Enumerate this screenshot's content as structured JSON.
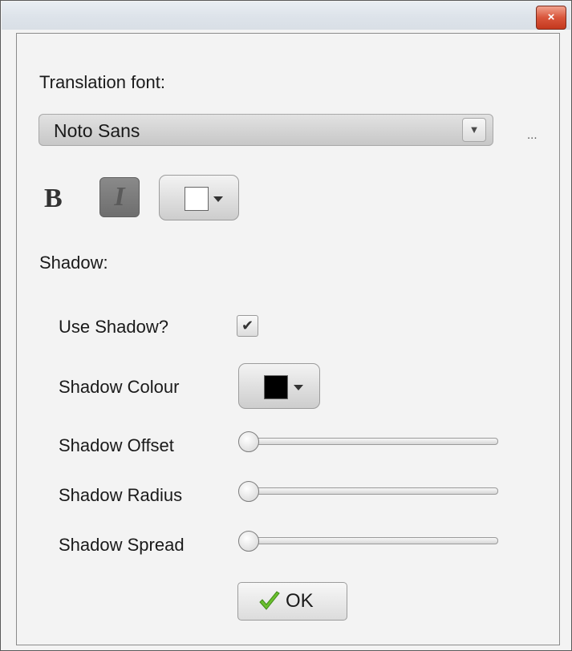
{
  "titlebar": {
    "close_icon": "close-icon",
    "close_glyph": "×"
  },
  "translation_font": {
    "label": "Translation font:",
    "selected": "Noto Sans",
    "more_label": "...",
    "dropdown_icon": "chevron-down-icon",
    "dropdown_glyph": "▼"
  },
  "style": {
    "bold_label": "B",
    "italic_label": "I",
    "italic_active": true,
    "font_color": "#ffffff"
  },
  "shadow": {
    "section_label": "Shadow:",
    "use_label": "Use Shadow?",
    "use_checked": true,
    "check_glyph": "✔",
    "colour_label": "Shadow Colour",
    "colour": "#000000",
    "offset_label": "Shadow Offset",
    "offset_value": 0,
    "radius_label": "Shadow Radius",
    "radius_value": 0,
    "spread_label": "Shadow Spread",
    "spread_value": 0
  },
  "ok_button": {
    "label": "OK",
    "icon": "checkmark-icon",
    "icon_color": "#6abf2e"
  }
}
